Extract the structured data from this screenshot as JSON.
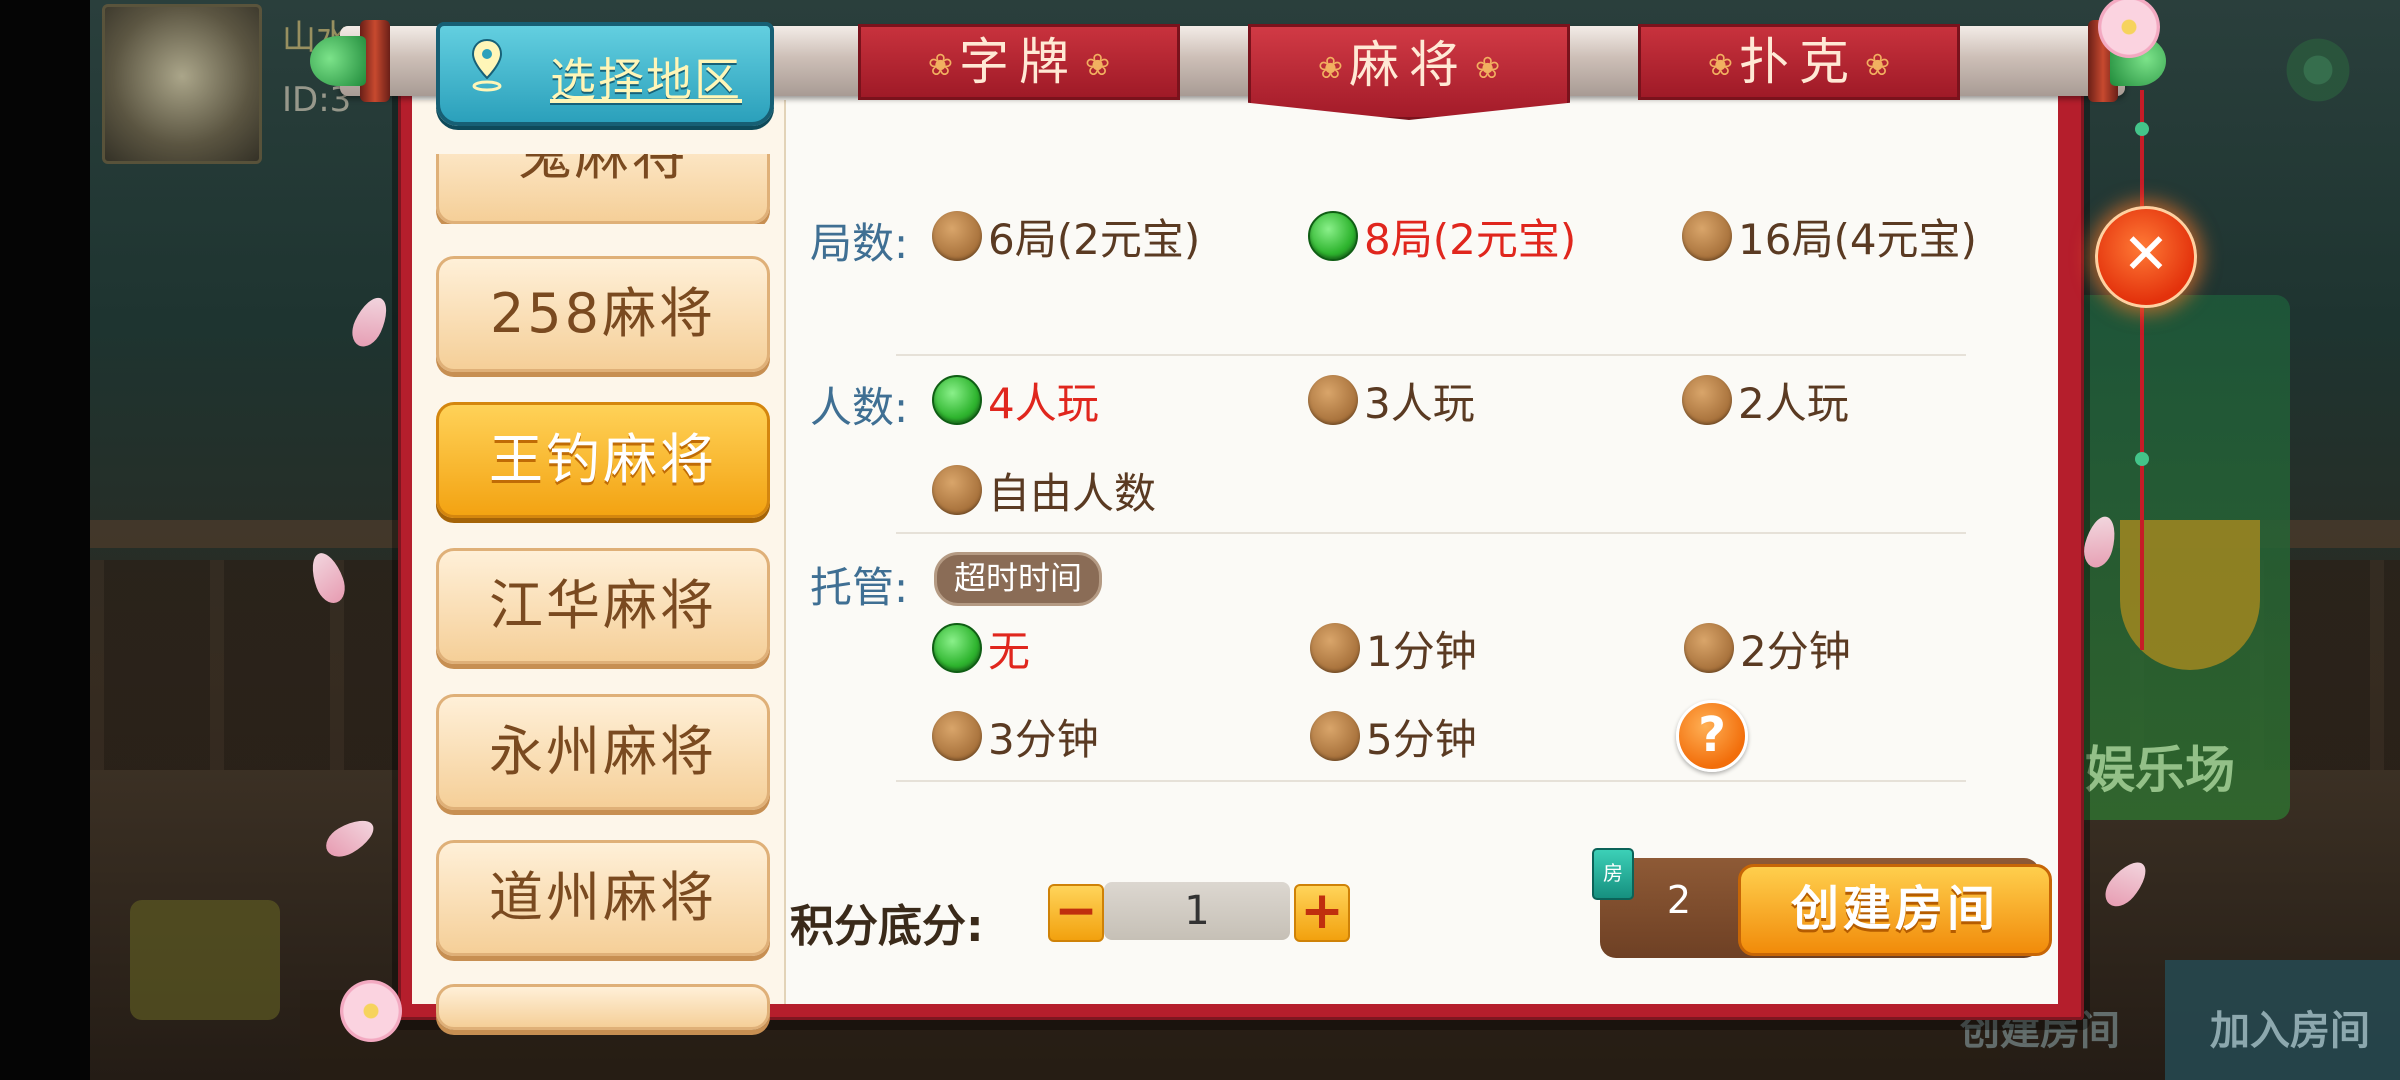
{
  "background": {
    "player_name": "山水",
    "player_id": "ID:3",
    "lobby_card_label": "娱乐场",
    "bottom_right_label": "加入房间",
    "bottom_create_label": "创建房间"
  },
  "header": {
    "region_button_label": "选择地区",
    "tabs": [
      {
        "label": "字牌",
        "active": false
      },
      {
        "label": "麻将",
        "active": true
      },
      {
        "label": "扑克",
        "active": false
      }
    ]
  },
  "sidebar": {
    "items": [
      {
        "label": "鬼麻将",
        "active": false
      },
      {
        "label": "258麻将",
        "active": false
      },
      {
        "label": "王钓麻将",
        "active": true
      },
      {
        "label": "江华麻将",
        "active": false
      },
      {
        "label": "永州麻将",
        "active": false
      },
      {
        "label": "道州麻将",
        "active": false
      }
    ]
  },
  "settings": {
    "rounds": {
      "label": "局数:",
      "options": [
        {
          "text": "6局(2元宝)",
          "selected": false
        },
        {
          "text": "8局(2元宝)",
          "selected": true
        },
        {
          "text": "16局(4元宝)",
          "selected": false
        }
      ]
    },
    "players": {
      "label": "人数:",
      "options": [
        {
          "text": "4人玩",
          "selected": true
        },
        {
          "text": "3人玩",
          "selected": false
        },
        {
          "text": "2人玩",
          "selected": false
        },
        {
          "text": "自由人数",
          "selected": false
        }
      ]
    },
    "auto_play": {
      "label": "托管:",
      "badge": "超时时间",
      "options": [
        {
          "text": "无",
          "selected": true
        },
        {
          "text": "1分钟",
          "selected": false
        },
        {
          "text": "2分钟",
          "selected": false
        },
        {
          "text": "3分钟",
          "selected": false
        },
        {
          "text": "5分钟",
          "selected": false
        }
      ],
      "help_icon": "?"
    }
  },
  "score": {
    "label": "积分底分:",
    "value": "1",
    "minus": "−",
    "plus": "+"
  },
  "create": {
    "card_icon_text": "房",
    "cost": "2",
    "button_label": "创建房间"
  },
  "close": {
    "symbol": "✕"
  },
  "colors": {
    "frame_red": "#b51e2c",
    "selected_text": "#e0261d",
    "label_blue": "#3f6f93",
    "accent_orange": "#f18b0a"
  }
}
